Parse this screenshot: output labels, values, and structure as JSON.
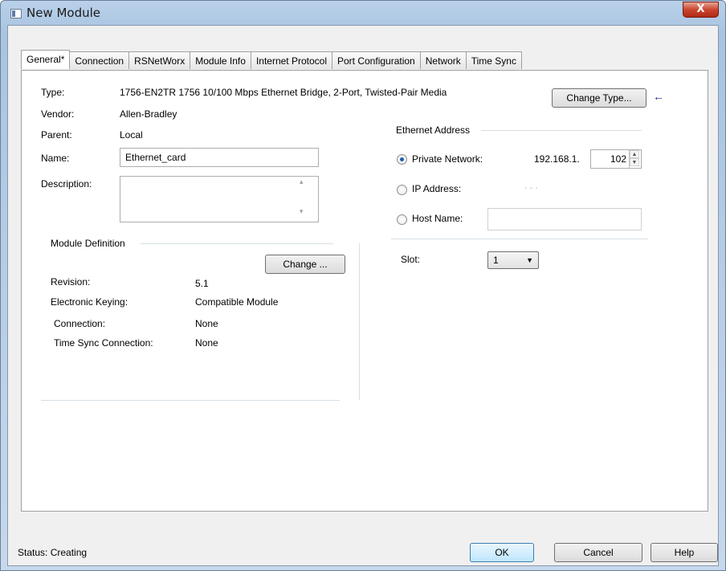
{
  "window": {
    "title": "New Module",
    "close_glyph": "X"
  },
  "tabs": [
    {
      "label": "General*",
      "active": true
    },
    {
      "label": "Connection"
    },
    {
      "label": "RSNetWorx"
    },
    {
      "label": "Module Info"
    },
    {
      "label": "Internet Protocol"
    },
    {
      "label": "Port Configuration"
    },
    {
      "label": "Network"
    },
    {
      "label": "Time Sync"
    }
  ],
  "general": {
    "type_label": "Type:",
    "type_value": "1756-EN2TR 1756 10/100 Mbps Ethernet Bridge, 2-Port, Twisted-Pair Media",
    "change_type_button": "Change Type...",
    "arrow": "←",
    "vendor_label": "Vendor:",
    "vendor_value": "Allen-Bradley",
    "parent_label": "Parent:",
    "parent_value": "Local",
    "name_label": "Name:",
    "name_value": "Ethernet_card",
    "description_label": "Description:",
    "description_value": ""
  },
  "module_definition": {
    "title": "Module Definition",
    "change_button": "Change ...",
    "revision_label": "Revision:",
    "revision_value": "5.1",
    "keying_label": "Electronic Keying:",
    "keying_value": "Compatible Module",
    "connection_label": "Connection:",
    "connection_value": "None",
    "time_sync_label": "Time Sync Connection:",
    "time_sync_value": "None"
  },
  "ethernet_address": {
    "title": "Ethernet Address",
    "private_network_label": "Private Network:",
    "private_network_prefix": "192.168.1.",
    "private_network_value": "102",
    "ip_address_label": "IP Address:",
    "ip_address_dots": ".          .          .",
    "host_name_label": "Host Name:",
    "host_name_value": "",
    "selected": "private_network"
  },
  "slot": {
    "label": "Slot:",
    "value": "1"
  },
  "footer": {
    "status_text": "Status:  Creating",
    "ok_button": "OK",
    "cancel_button": "Cancel",
    "help_button": "Help"
  }
}
